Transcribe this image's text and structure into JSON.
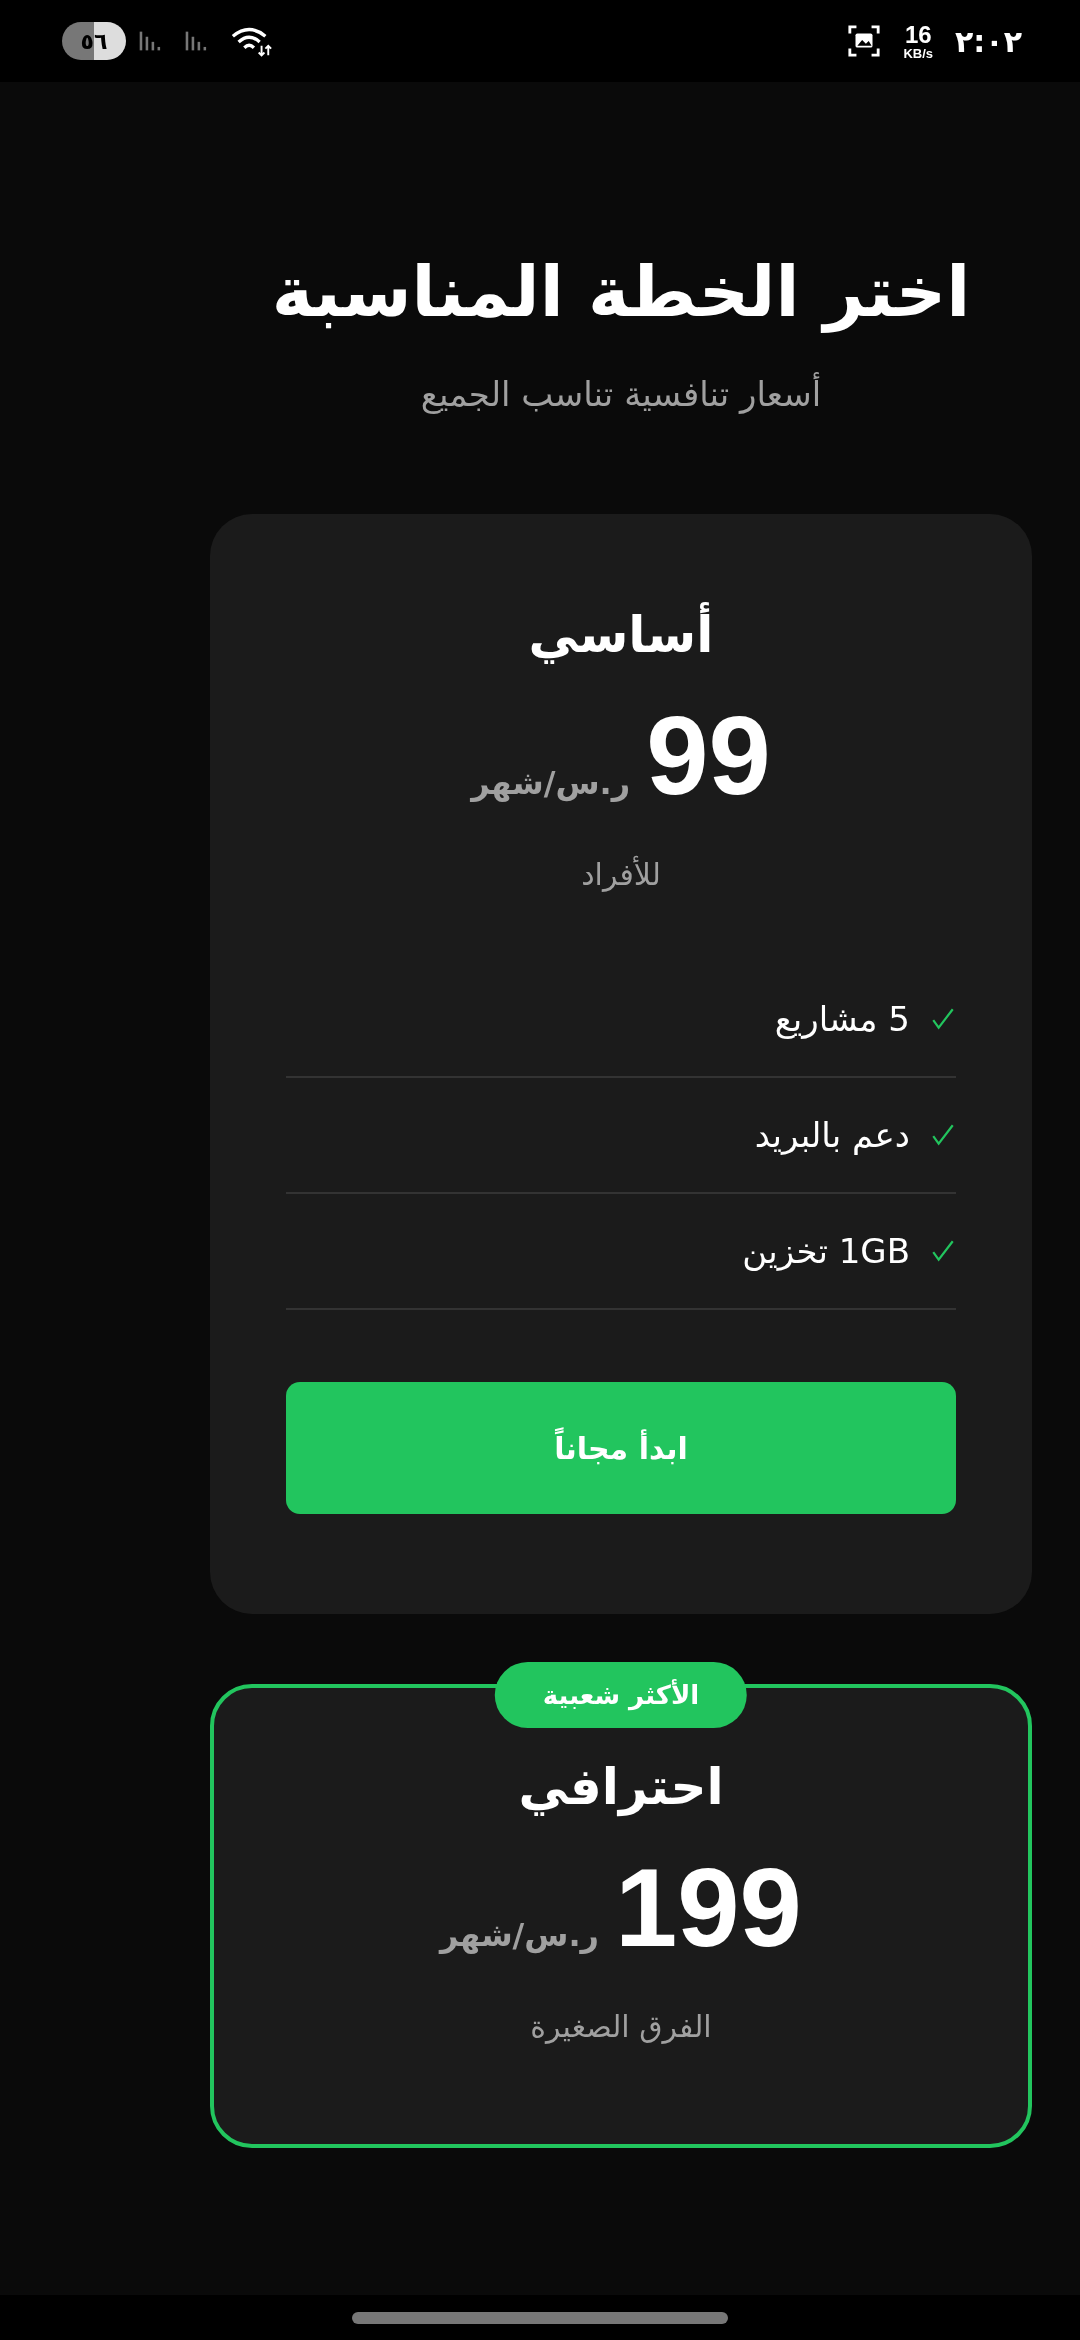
{
  "status_bar": {
    "battery": "٥٦",
    "net_speed": "16",
    "net_unit": "KB/s",
    "time": "٢:٠٢"
  },
  "header": {
    "title": "اختر الخطة المناسبة",
    "subtitle": "أسعار تنافسية تناسب الجميع"
  },
  "plans": [
    {
      "name": "أساسي",
      "price": "99",
      "currency": "ر.س/شهر",
      "audience": "للأفراد",
      "highlighted": false,
      "features": [
        "5 مشاريع",
        "دعم بالبريد",
        "1GB تخزين"
      ],
      "button": "ابدأ مجاناً"
    },
    {
      "name": "احترافي",
      "price": "199",
      "currency": "ر.س/شهر",
      "audience": "الفرق الصغيرة",
      "highlighted": true,
      "badge": "الأكثر شعبية"
    }
  ]
}
